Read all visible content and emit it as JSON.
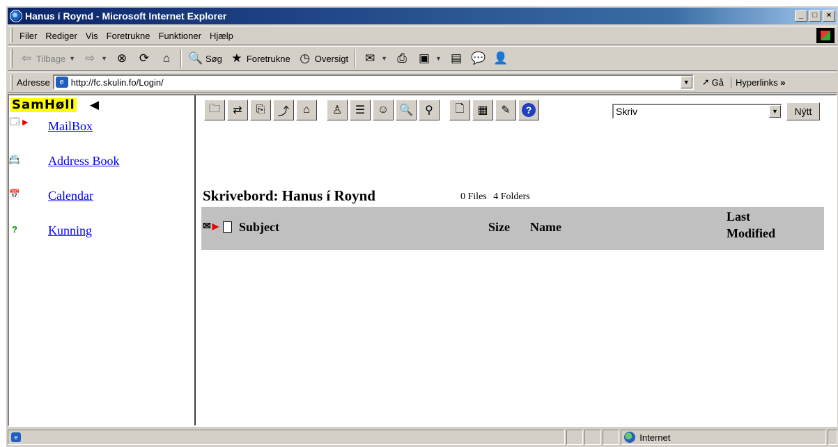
{
  "window": {
    "title": "Hanus í Roynd - Microsoft Internet Explorer",
    "buttons": [
      "_",
      "□",
      "×"
    ]
  },
  "menu": {
    "items": [
      {
        "label": "Filer"
      },
      {
        "label": "Rediger"
      },
      {
        "label": "Vis"
      },
      {
        "label": "Foretrukne"
      },
      {
        "label": "Funktioner"
      },
      {
        "label": "Hjælp"
      }
    ]
  },
  "toolbar": {
    "back": "Tilbage",
    "search": "Søg",
    "favorites": "Foretrukne",
    "history": "Oversigt"
  },
  "address": {
    "label": "Adresse",
    "url": "http://fc.skulin.fo/Login/",
    "go": "Gå",
    "links": "Hyperlinks"
  },
  "sidebar": {
    "brand": "SamHøll",
    "items": [
      {
        "label": "MailBox",
        "icon": "mailbox-icon"
      },
      {
        "label": "Address Book",
        "icon": "address-book-icon"
      },
      {
        "label": "Calendar",
        "icon": "calendar-icon"
      },
      {
        "label": "Kunning",
        "icon": "help-question-icon"
      }
    ]
  },
  "apptoolbar": {
    "select_value": "Skriv",
    "new_button": "Nýtt"
  },
  "folder": {
    "title": "Skrivebord: Hanus í Roynd",
    "files": "0 Files",
    "folders": "4 Folders"
  },
  "columns": {
    "subject": "Subject",
    "size": "Size",
    "name": "Name",
    "last_line1": "Last",
    "last_line2": "Modified"
  },
  "status": {
    "zone": "Internet"
  }
}
